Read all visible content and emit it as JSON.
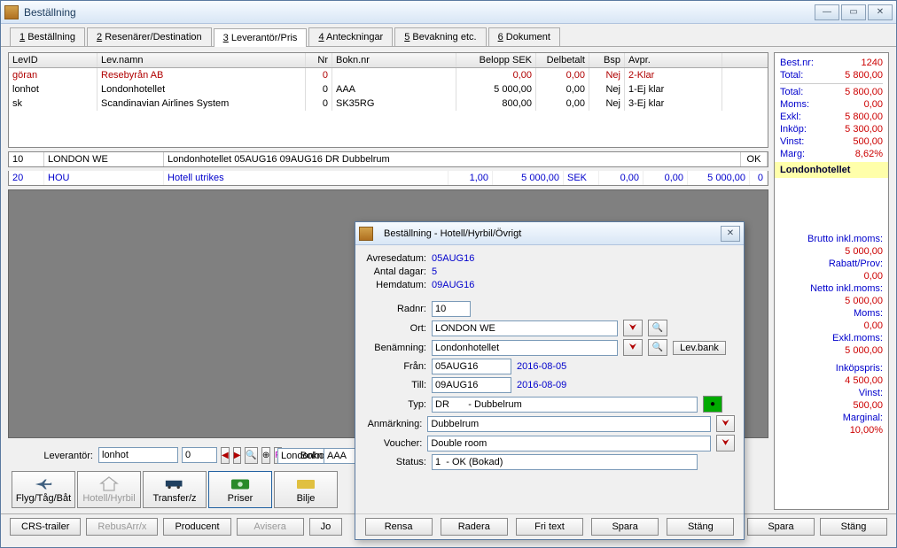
{
  "window": {
    "title": "Beställning"
  },
  "tabs": [
    {
      "num": "1",
      "label": "Beställning"
    },
    {
      "num": "2",
      "label": "Resenärer/Destination"
    },
    {
      "num": "3",
      "label": "Leverantör/Pris"
    },
    {
      "num": "4",
      "label": "Anteckningar"
    },
    {
      "num": "5",
      "label": "Bevakning etc."
    },
    {
      "num": "6",
      "label": "Dokument"
    }
  ],
  "grid_headers": {
    "levid": "LevID",
    "levnamn": "Lev.namn",
    "nr": "Nr",
    "bokn": "Bokn.nr",
    "belopp": "Belopp SEK",
    "delb": "Delbetalt",
    "bsp": "Bsp",
    "avpr": "Avpr."
  },
  "grid_rows": [
    {
      "levid": "göran",
      "levnamn": "Resebyrån AB",
      "nr": "0",
      "bokn": "",
      "belopp": "0,00",
      "delb": "0,00",
      "bsp": "Nej",
      "avpr": "2-Klar",
      "red": true
    },
    {
      "levid": "lonhot",
      "levnamn": "Londonhotellet",
      "nr": "0",
      "bokn": "AAA",
      "belopp": "5 000,00",
      "delb": "0,00",
      "bsp": "Nej",
      "avpr": "1-Ej klar"
    },
    {
      "levid": "sk",
      "levnamn": "Scandinavian Airlines System",
      "nr": "0",
      "bokn": "SK35RG",
      "belopp": "800,00",
      "delb": "0,00",
      "bsp": "Nej",
      "avpr": "3-Ej klar"
    }
  ],
  "seg1": {
    "c0": "10",
    "c1": "LONDON WE",
    "c2": "Londonhotellet  05AUG16  09AUG16  DR   Dubbelrum",
    "ok": "OK"
  },
  "seg2": {
    "c0": "20",
    "c1": "HOU",
    "c2": "Hotell utrikes",
    "c3": "1,00",
    "c4": "5 000,00",
    "c5": "SEK",
    "c6": "0,00",
    "c7": "0,00",
    "c8": "5 000,00",
    "c9": "0"
  },
  "lev_form": {
    "lev_label": "Leverantör:",
    "lev_val": "lonhot",
    "lev_n": "0",
    "lev_name": "Londonhotellet",
    "bokn_label": "Bokningsnr:",
    "bokn_val": "AAA"
  },
  "bigbtns": [
    {
      "label": "Flyg/Tåg/Båt",
      "key": "flight"
    },
    {
      "label": "Hotell/Hyrbil",
      "key": "hotel",
      "disabled": true
    },
    {
      "label": "Transfer/z",
      "key": "transfer"
    },
    {
      "label": "Priser",
      "key": "prices"
    },
    {
      "label": "Bilje",
      "key": "ticket"
    }
  ],
  "bottom": {
    "crs": "CRS-trailer",
    "rebus": "RebusArr/x",
    "prod": "Producent",
    "avis": "Avisera",
    "jo": "Jo",
    "spara": "Spara",
    "stang": "Stäng"
  },
  "summary": {
    "bestnr_l": "Best.nr:",
    "bestnr_v": "1240",
    "total_l": "Total:",
    "total_v": "5 800,00",
    "total2_l": "Total:",
    "total2_v": "5 800,00",
    "moms_l": "Moms:",
    "moms_v": "0,00",
    "exkl_l": "Exkl:",
    "exkl_v": "5 800,00",
    "inkop_l": "Inköp:",
    "inkop_v": "5 300,00",
    "vinst_l": "Vinst:",
    "vinst_v": "500,00",
    "marg_l": "Marg:",
    "marg_v": "8,62%",
    "hl": "Londonhotellet",
    "brutto_l": "Brutto inkl.moms:",
    "brutto_v": "5 000,00",
    "rabatt_l": "Rabatt/Prov:",
    "rabatt_v": "0,00",
    "netto_l": "Netto inkl.moms:",
    "netto_v": "5 000,00",
    "moms2_l": "Moms:",
    "moms2_v": "0,00",
    "exkl2_l": "Exkl.moms:",
    "exkl2_v": "5 000,00",
    "inkops_l": "Inköpspris:",
    "inkops_v": "4 500,00",
    "vinst2_l": "Vinst:",
    "vinst2_v": "500,00",
    "marg2_l": "Marginal:",
    "marg2_v": "10,00%"
  },
  "dialog": {
    "title": "Beställning - Hotell/Hyrbil/Övrigt",
    "avres_l": "Avresedatum:",
    "avres_v": "05AUG16",
    "dagar_l": "Antal dagar:",
    "dagar_v": "5",
    "hem_l": "Hemdatum:",
    "hem_v": "09AUG16",
    "radn_l": "Radnr:",
    "radn_v": "10",
    "ort_l": "Ort:",
    "ort_v": "LONDON WE",
    "ben_l": "Benämning:",
    "ben_v": "Londonhotellet",
    "levbank": "Lev.bank",
    "fran_l": "Från:",
    "fran_v": "05AUG16",
    "fran_d": "2016-08-05",
    "till_l": "Till:",
    "till_v": "09AUG16",
    "till_d": "2016-08-09",
    "typ_l": "Typ:",
    "typ_v": "DR       - Dubbelrum",
    "anm_l": "Anmärkning:",
    "anm_v": "Dubbelrum",
    "vou_l": "Voucher:",
    "vou_v": "Double room",
    "sta_l": "Status:",
    "sta_v": "1  - OK (Bokad)",
    "b_rensa": "Rensa",
    "b_radera": "Radera",
    "b_fritext": "Fri text",
    "b_spara": "Spara",
    "b_stang": "Stäng"
  }
}
